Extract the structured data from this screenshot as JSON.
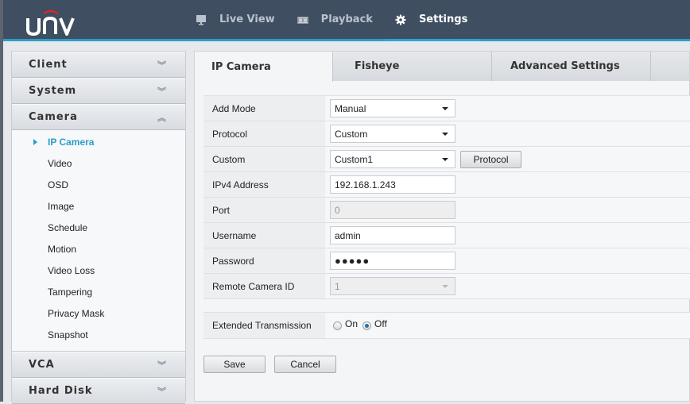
{
  "brand": {
    "logo_text": "UNV",
    "accent": "#2a9ec9",
    "header_bg": "#3f4e61",
    "logo_arc": "#d9262c"
  },
  "nav": [
    {
      "label": "Live View",
      "icon": "monitor-icon",
      "active": false
    },
    {
      "label": "Playback",
      "icon": "film-icon",
      "active": false
    },
    {
      "label": "Settings",
      "icon": "gear-icon",
      "active": true
    }
  ],
  "sidebar": {
    "sections": [
      {
        "label": "Client",
        "expanded": false
      },
      {
        "label": "System",
        "expanded": false
      },
      {
        "label": "Camera",
        "expanded": true
      },
      {
        "label": "VCA",
        "expanded": false
      },
      {
        "label": "Hard Disk",
        "expanded": false
      }
    ],
    "camera_items": [
      {
        "label": "IP Camera",
        "active": true
      },
      {
        "label": "Video"
      },
      {
        "label": "OSD"
      },
      {
        "label": "Image"
      },
      {
        "label": "Schedule"
      },
      {
        "label": "Motion"
      },
      {
        "label": "Video Loss"
      },
      {
        "label": "Tampering"
      },
      {
        "label": "Privacy Mask"
      },
      {
        "label": "Snapshot"
      }
    ]
  },
  "tabs": [
    {
      "label": "IP Camera",
      "active": true
    },
    {
      "label": "Fisheye"
    },
    {
      "label": "Advanced Settings"
    }
  ],
  "form": {
    "add_mode": {
      "label": "Add Mode",
      "value": "Manual"
    },
    "protocol": {
      "label": "Protocol",
      "value": "Custom"
    },
    "custom": {
      "label": "Custom",
      "value": "Custom1",
      "button": "Protocol"
    },
    "ipv4": {
      "label": "IPv4 Address",
      "value": "192.168.1.243"
    },
    "port": {
      "label": "Port",
      "value": "0"
    },
    "username": {
      "label": "Username",
      "value": "admin"
    },
    "password": {
      "label": "Password",
      "value": "●●●●●"
    },
    "remote_id": {
      "label": "Remote Camera ID",
      "value": "1"
    }
  },
  "extended": {
    "label": "Extended Transmission",
    "on_label": "On",
    "off_label": "Off",
    "selected": "Off"
  },
  "actions": {
    "save": "Save",
    "cancel": "Cancel"
  }
}
